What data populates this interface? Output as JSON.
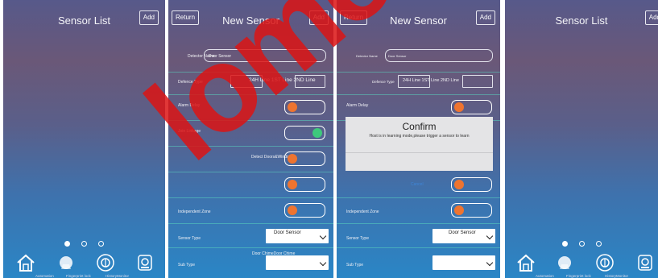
{
  "screens": {
    "sensor_list_1": {
      "title": "Sensor List",
      "add": "Add"
    },
    "new_sensor_1": {
      "return": "Return",
      "title": "New Sensor",
      "add": "Add",
      "detector_name_label": "Detector Name",
      "detector_name_value": "Door Sensor",
      "defence_type_label": "Defence Type",
      "defence_type_value": "24H Line 1ST Line 2ND Line",
      "alarm_delay": "Alarm Delay",
      "join_linkage": "Join Linkage",
      "detect_door_window": "Detect Doors&Windows",
      "independent_zone": "Independent Zone",
      "sensor_type_label": "Sensor Type",
      "sensor_type_value": "Door Sensor",
      "sub_type_label": "Sub Type",
      "sub_type_value": "Door  ChimeDoor  Chime"
    },
    "new_sensor_2": {
      "return": "Return",
      "title": "New Sensor",
      "add": "Add",
      "detector_name_label": "Detector Name",
      "detector_name_value": "Door Sensor",
      "defence_type_label": "Defence Type",
      "defence_type_value": "24H Line 1ST Line 2ND Line",
      "alarm_delay": "Alarm Delay",
      "cancel": "Cancel",
      "independent_zone": "Independent Zone",
      "sensor_type_label": "Sensor Type",
      "sensor_type_value": "Door Sensor",
      "sub_type_label": "Sub Type",
      "dialog": {
        "title": "Confirm",
        "message": "Host is in learning mode,please trigger a sensor to learn"
      }
    },
    "sensor_list_2": {
      "title": "Sensor List",
      "add": "Add"
    }
  },
  "nav_labels": [
    "Automation",
    "Fingerprint lock",
    "HistoryMonitor"
  ],
  "watermark": "lome",
  "colors": {
    "accent_orange": "#ee7430",
    "accent_green": "#3ec97c",
    "divider": "#5ad2be",
    "watermark": "#dc1414"
  }
}
